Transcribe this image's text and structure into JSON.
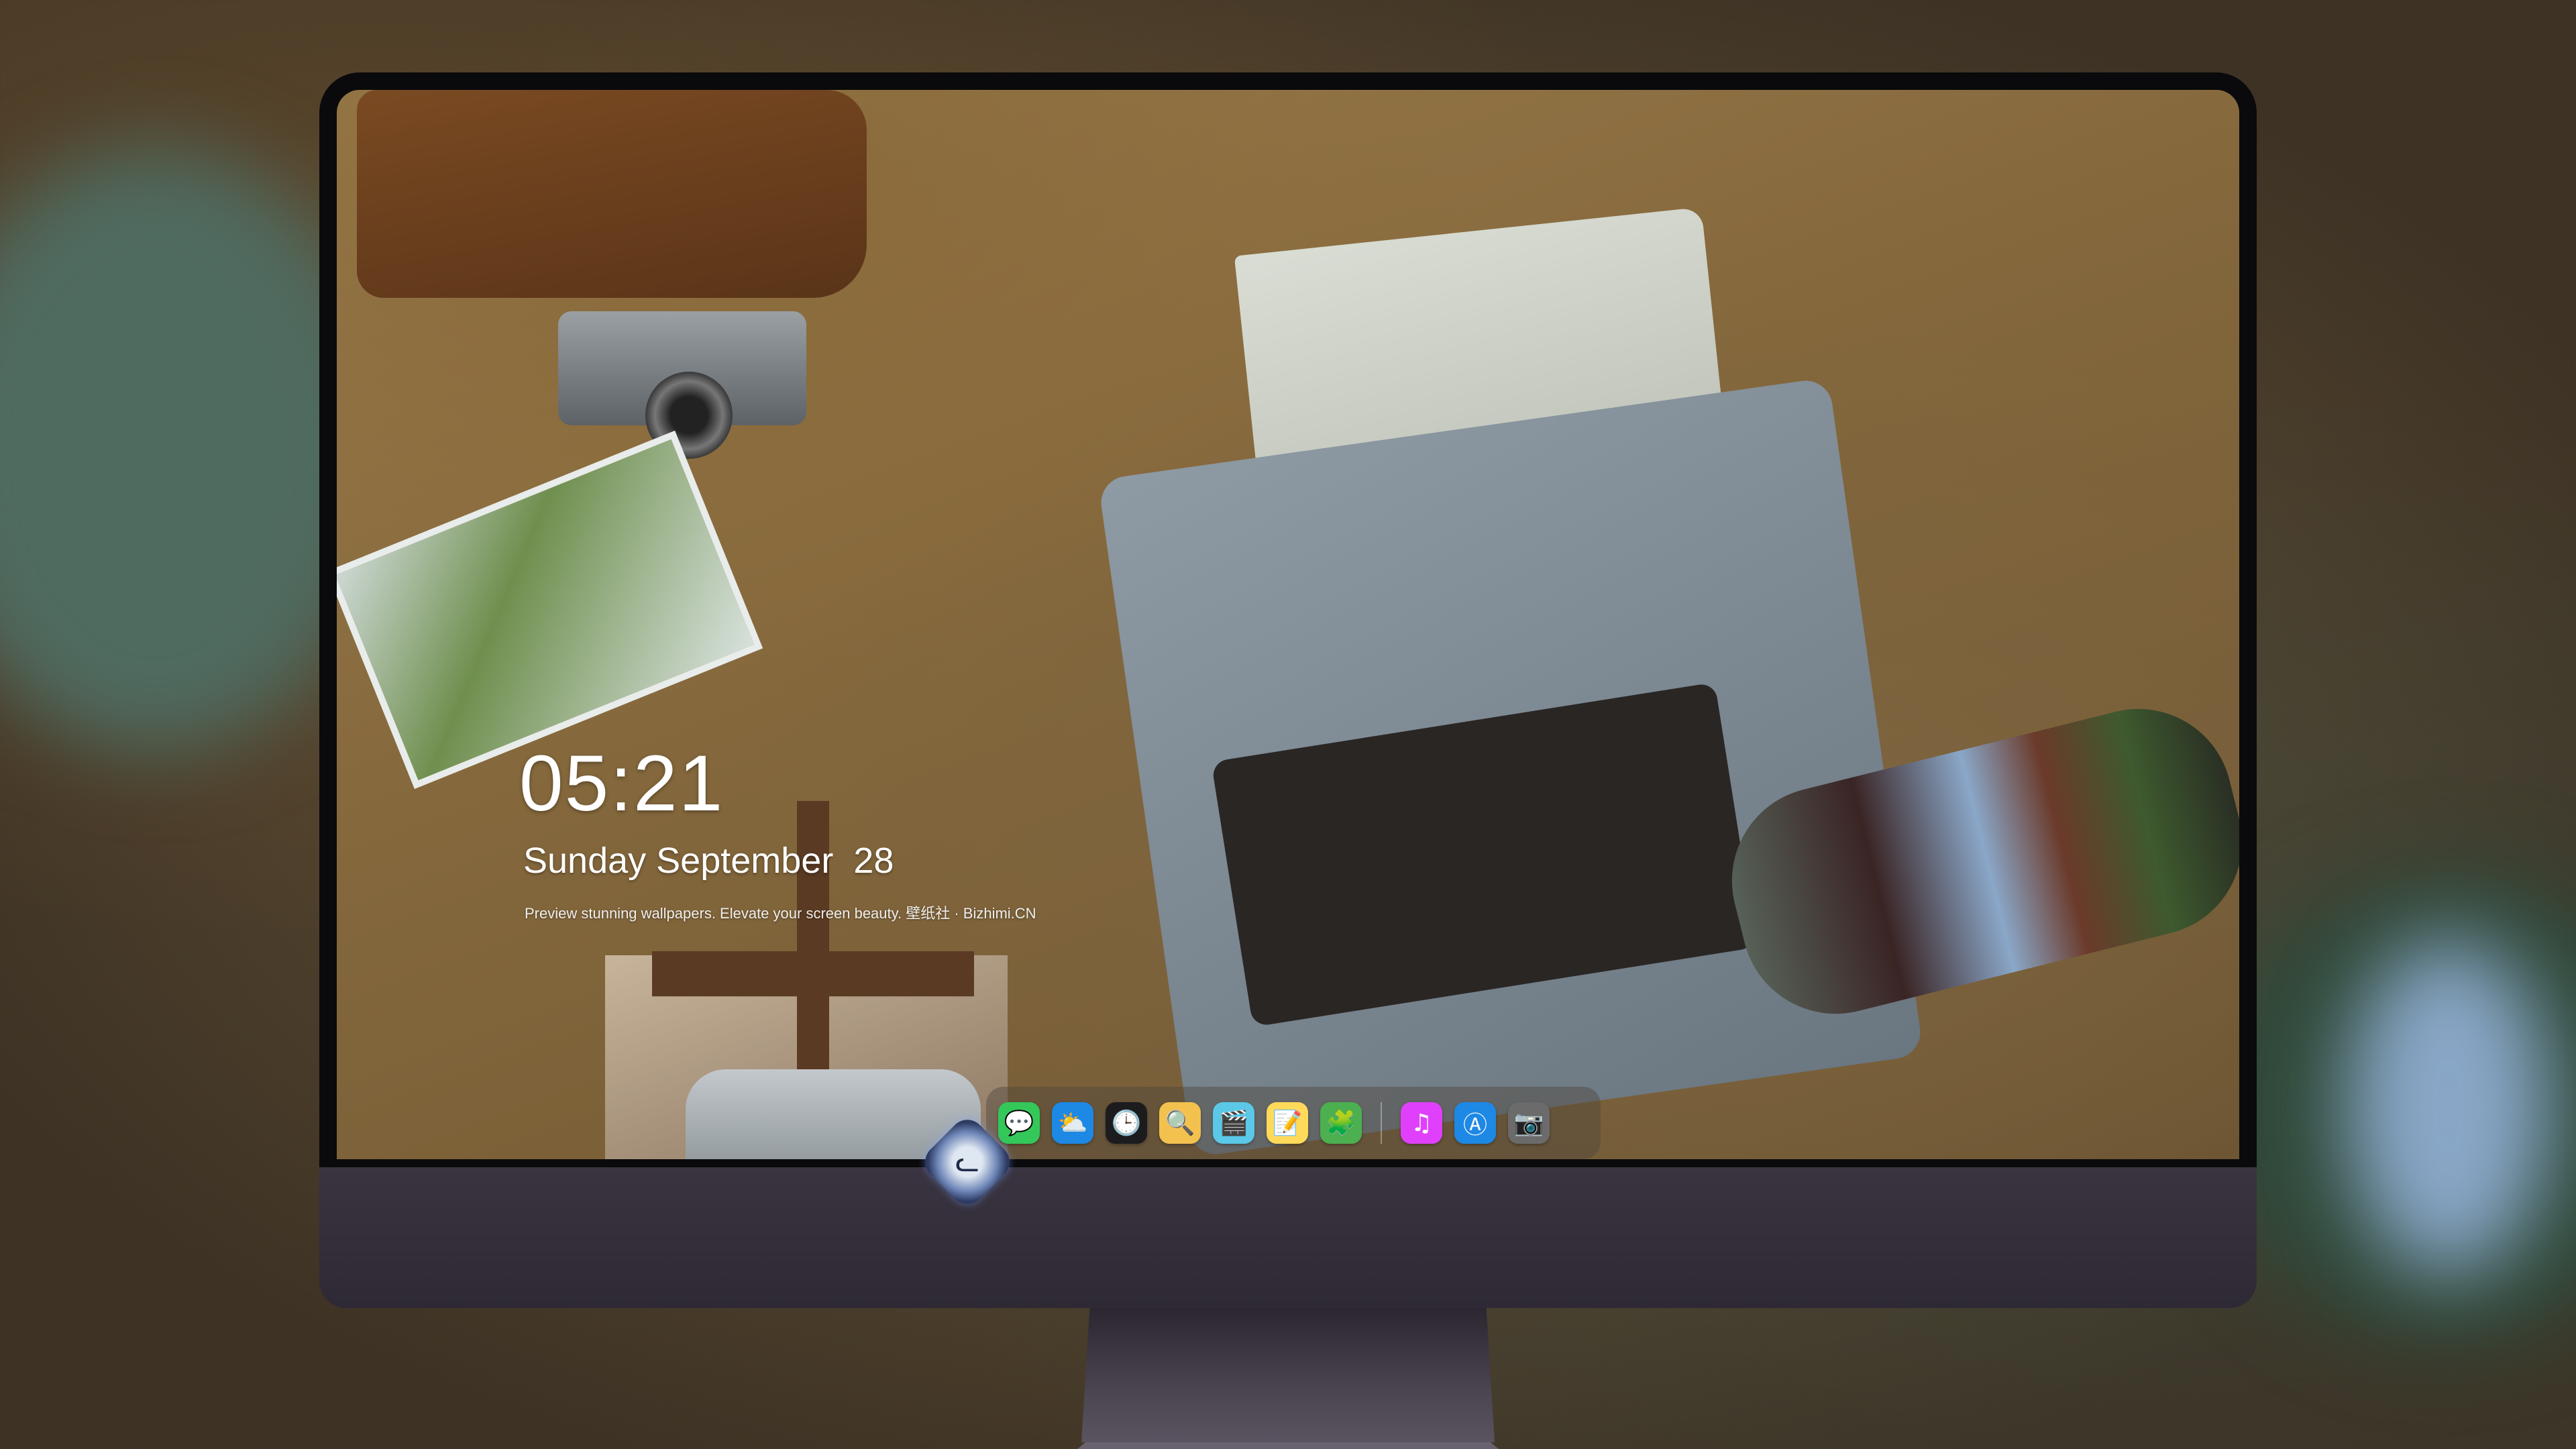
{
  "lock_screen": {
    "time": "05:21",
    "date": "Sunday September  28",
    "tagline": "Preview stunning wallpapers. Elevate your screen beauty. 壁纸社 · Bizhimi.CN"
  },
  "dock": {
    "items": [
      {
        "name": "messages",
        "glyph": "💬",
        "color": "#34c759"
      },
      {
        "name": "weather",
        "glyph": "⛅",
        "color": "#1e88e5"
      },
      {
        "name": "clock",
        "glyph": "🕒",
        "color": "#1c1c1e"
      },
      {
        "name": "preview",
        "glyph": "🔍",
        "color": "#f2c14e"
      },
      {
        "name": "claquette",
        "glyph": "🎬",
        "color": "#5ac8e6"
      },
      {
        "name": "notes",
        "glyph": "📝",
        "color": "#ffd95a"
      },
      {
        "name": "photo-booth",
        "glyph": "🧩",
        "color": "#4caf50"
      },
      {
        "name": "music",
        "glyph": "♫",
        "color": "#e040fb"
      },
      {
        "name": "app-store",
        "glyph": "Ⓐ",
        "color": "#1e88e5"
      },
      {
        "name": "camera",
        "glyph": "📷",
        "color": "#6b6b6b"
      }
    ]
  },
  "monitor": {
    "logo_icon": "cat-mascot-icon"
  }
}
